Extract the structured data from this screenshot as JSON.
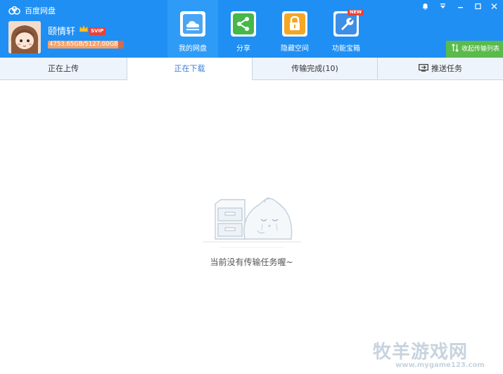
{
  "app": {
    "title": "百度网盘"
  },
  "user": {
    "name": "颐情轩",
    "badge": "SVIP",
    "quota_text": "4753.65GB/5127.00GB",
    "quota_fraction": 0.927
  },
  "nav": [
    {
      "label": "我的网盘",
      "icon": "cloud-drive-icon",
      "active": true
    },
    {
      "label": "分享",
      "icon": "share-icon",
      "active": false
    },
    {
      "label": "隐藏空间",
      "icon": "lock-icon",
      "active": false
    },
    {
      "label": "功能宝箱",
      "icon": "toolbox-icon",
      "badge": "NEW",
      "active": false
    }
  ],
  "window_controls": [
    "bell-icon",
    "dropdown-icon",
    "minimize-icon",
    "maximize-icon",
    "close-icon"
  ],
  "collapse_label": "收起传输列表",
  "tabs": [
    {
      "label": "正在上传",
      "active": false
    },
    {
      "label": "正在下载",
      "active": true
    },
    {
      "label": "传输完成(10)",
      "active": false
    },
    {
      "label": "推送任务",
      "active": false
    }
  ],
  "empty": {
    "message": "当前没有传输任务喔~"
  },
  "watermark": {
    "line1": "牧羊游戏网",
    "line2": "www.mygame123.com"
  },
  "colors": {
    "header": "#1f8ff4",
    "active_nav": "#2e9bf6",
    "collapse_bg": "#5aba4b",
    "tab_active_text": "#3b7ed8"
  }
}
